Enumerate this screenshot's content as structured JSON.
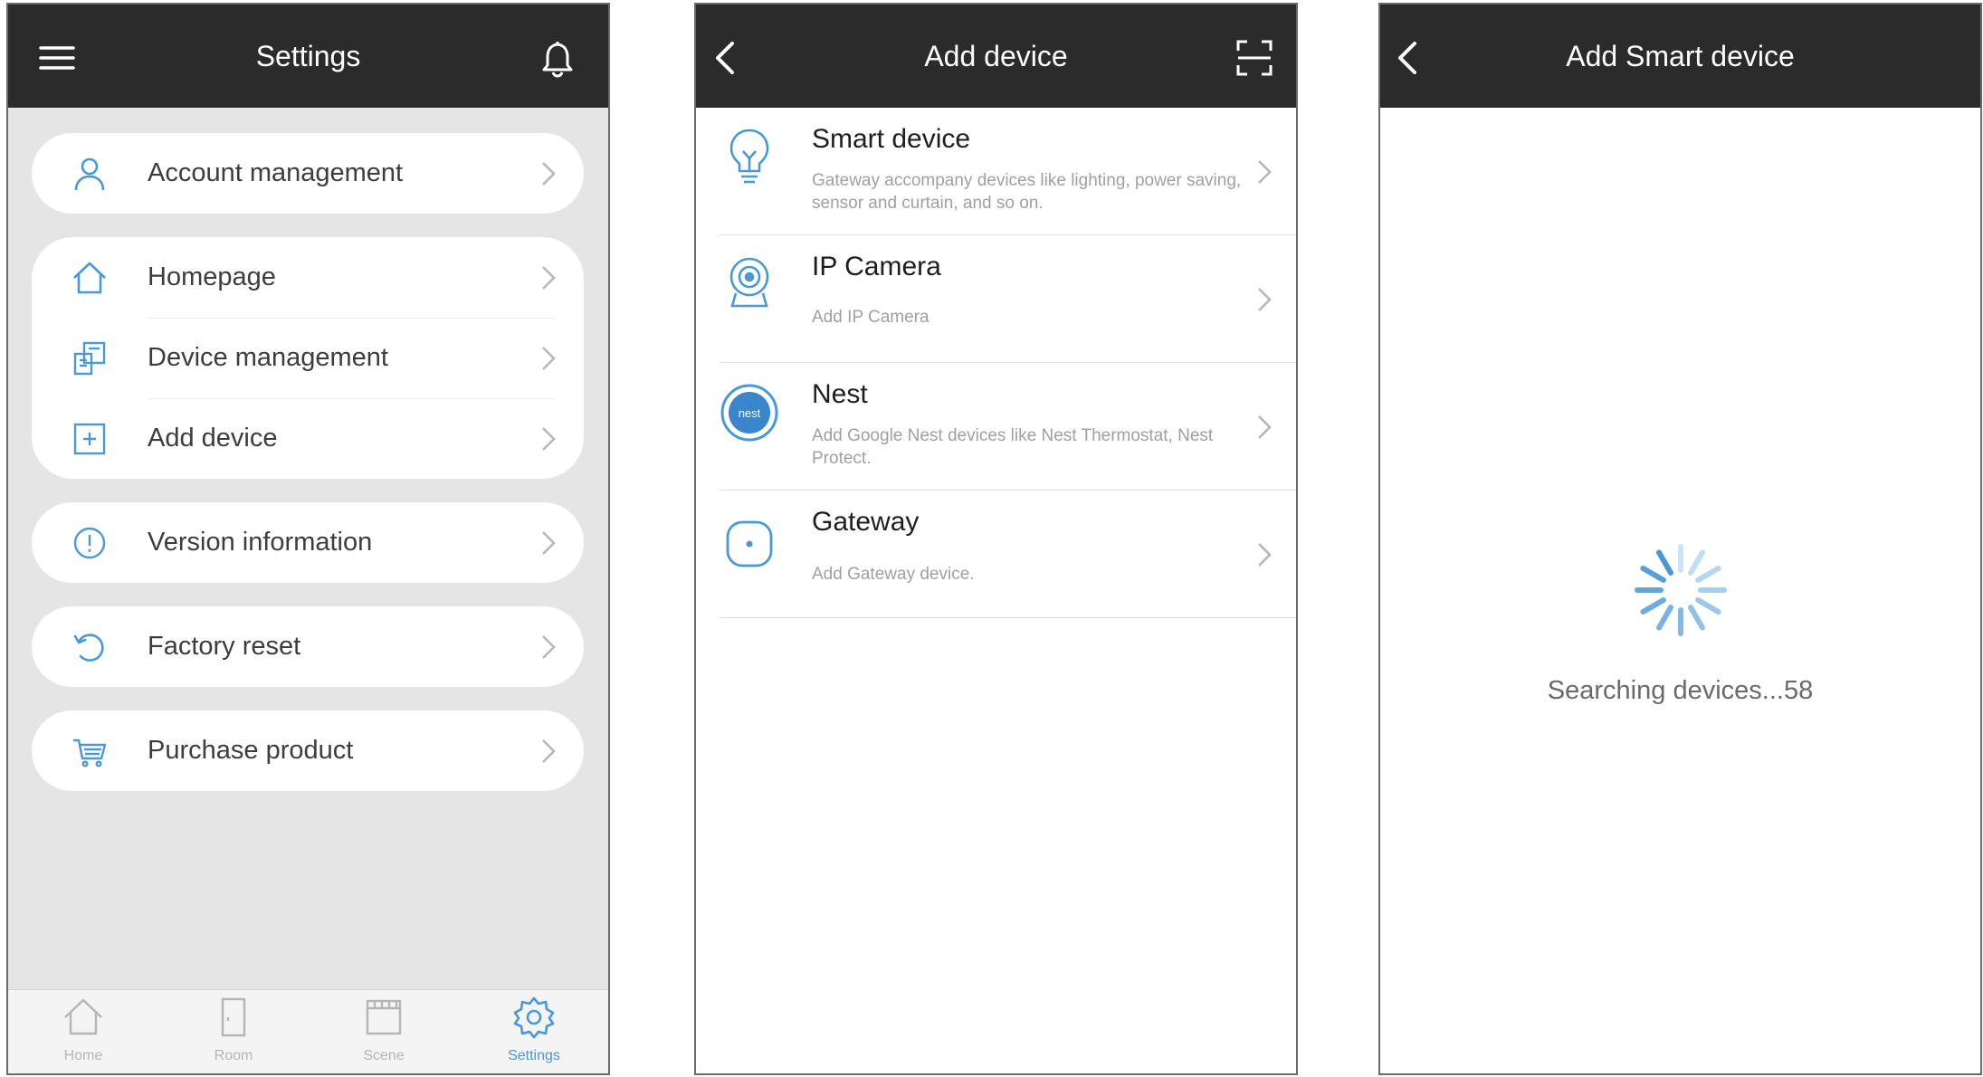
{
  "colors": {
    "header_bg": "#2b2b2b",
    "settings_bg": "#e5e5e5",
    "accent_blue": "#4a98d6",
    "muted_text": "#a0a0a0"
  },
  "settings_screen": {
    "title": "Settings",
    "menu_icon": "hamburger-menu-icon",
    "bell_icon": "bell-icon",
    "items": [
      {
        "label": "Account management",
        "icon": "user-icon"
      },
      {
        "label": "Homepage",
        "icon": "home-icon"
      },
      {
        "label": "Device management",
        "icon": "device-management-icon"
      },
      {
        "label": "Add device",
        "icon": "add-box-icon"
      },
      {
        "label": "Version information",
        "icon": "info-icon"
      },
      {
        "label": "Factory reset",
        "icon": "reset-icon"
      },
      {
        "label": "Purchase product",
        "icon": "cart-icon"
      }
    ],
    "tabs": [
      {
        "label": "Home",
        "icon": "home-tab-icon",
        "active": false
      },
      {
        "label": "Room",
        "icon": "room-door-icon",
        "active": false
      },
      {
        "label": "Scene",
        "icon": "scene-clapper-icon",
        "active": false
      },
      {
        "label": "Settings",
        "icon": "gear-icon",
        "active": true
      }
    ]
  },
  "add_device_screen": {
    "title": "Add device",
    "back_icon": "back-arrow-icon",
    "scan_icon": "scan-icon",
    "devices": [
      {
        "title": "Smart device",
        "description": "Gateway accompany devices like lighting, power saving, sensor and curtain, and so on.",
        "icon": "lightbulb-icon"
      },
      {
        "title": "IP Camera",
        "description": "Add IP Camera",
        "icon": "ip-camera-icon"
      },
      {
        "title": "Nest",
        "description": "Add Google Nest devices like Nest Thermostat, Nest Protect.",
        "icon": "nest-logo-icon",
        "icon_text": "nest"
      },
      {
        "title": "Gateway",
        "description": "Add Gateway device.",
        "icon": "gateway-icon"
      }
    ]
  },
  "add_smart_device_screen": {
    "title": "Add Smart device",
    "back_icon": "back-arrow-icon",
    "spinner_icon": "loading-spinner-icon",
    "status_text": "Searching devices...58"
  }
}
